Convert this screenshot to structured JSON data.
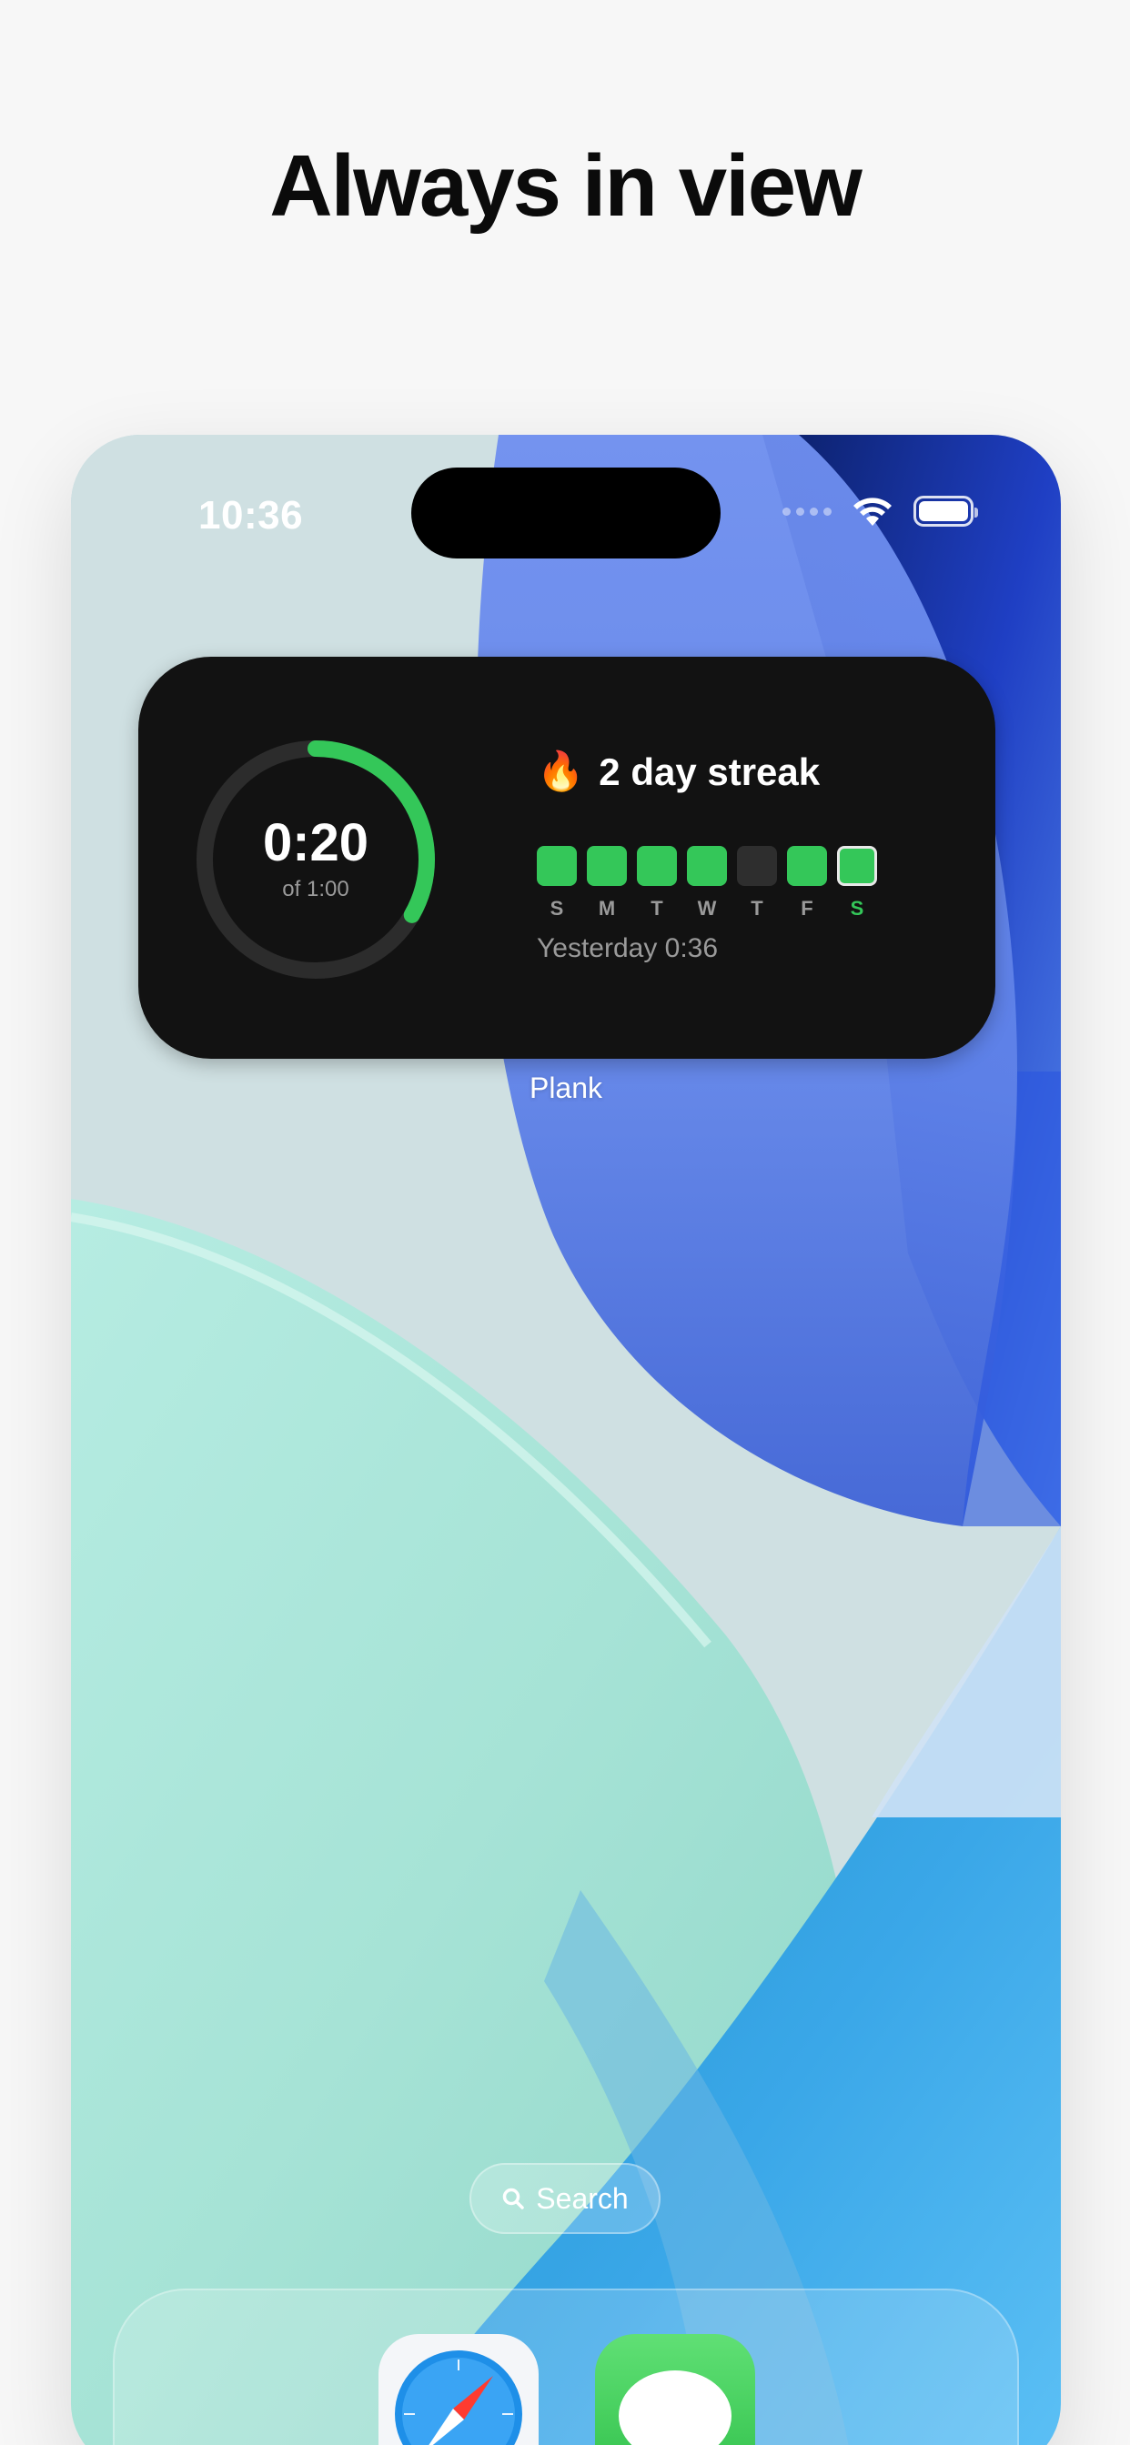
{
  "headline": "Always in view",
  "status_bar": {
    "time": "10:36",
    "icons": [
      "signal-dots-icon",
      "wifi-icon",
      "battery-icon"
    ]
  },
  "widget": {
    "timer": {
      "elapsed": "0:20",
      "goal": "of 1:00",
      "progress_fraction": 0.333
    },
    "streak": {
      "emoji": "🔥",
      "title": "2 day streak"
    },
    "week": [
      {
        "label": "S",
        "done": true,
        "today": false
      },
      {
        "label": "M",
        "done": true,
        "today": false
      },
      {
        "label": "T",
        "done": true,
        "today": false
      },
      {
        "label": "W",
        "done": true,
        "today": false
      },
      {
        "label": "T",
        "done": false,
        "today": false
      },
      {
        "label": "F",
        "done": true,
        "today": false
      },
      {
        "label": "S",
        "done": true,
        "today": true
      }
    ],
    "yesterday": "Yesterday 0:36",
    "label": "Plank"
  },
  "search": {
    "label": "Search",
    "icon": "search-icon"
  },
  "dock": {
    "apps": [
      {
        "name": "Safari",
        "icon": "compass-icon"
      },
      {
        "name": "Messages",
        "icon": "message-bubble-icon"
      }
    ]
  },
  "colors": {
    "accent_green": "#34c759",
    "widget_bg": "#121212",
    "inactive_day": "#2e2e2e",
    "ring_track": "#2c2c2c"
  }
}
